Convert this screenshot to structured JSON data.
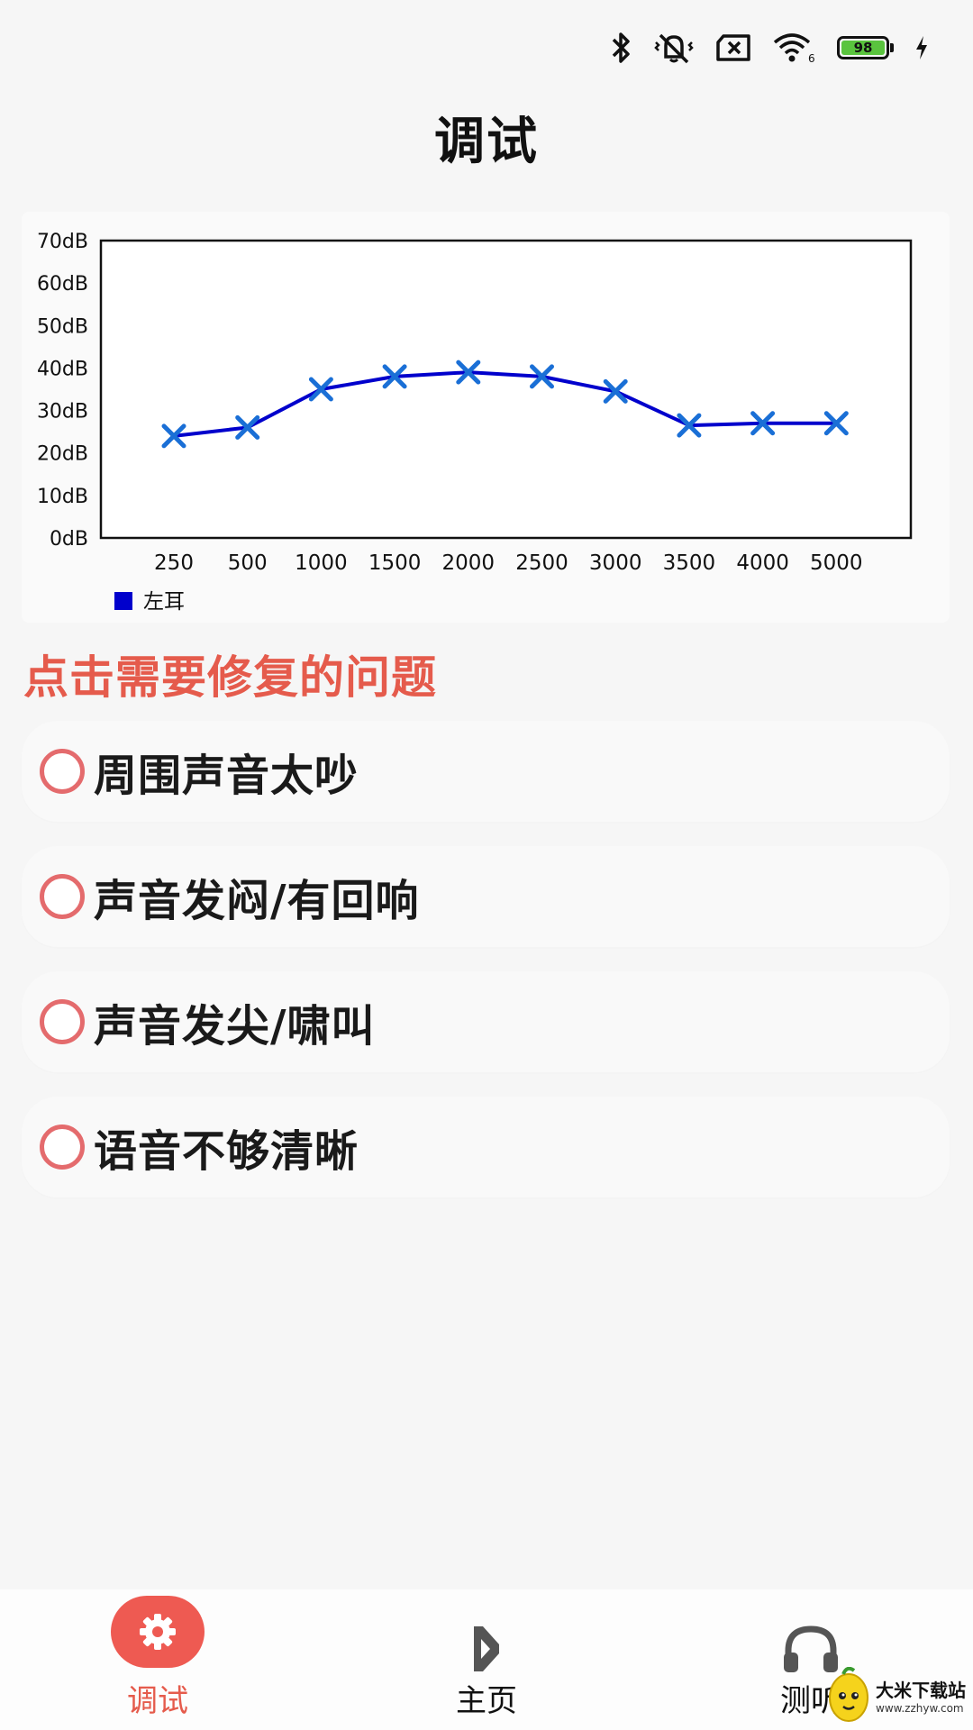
{
  "status_bar": {
    "battery_level": "98",
    "wifi_badge": "6",
    "icons": [
      "bluetooth-icon",
      "mute-vibrate-icon",
      "sim-off-icon",
      "wifi-icon",
      "battery-icon",
      "charging-icon"
    ]
  },
  "header": {
    "title": "调试"
  },
  "chart_data": {
    "type": "line",
    "categories": [
      "250",
      "500",
      "1000",
      "1500",
      "2000",
      "2500",
      "3000",
      "3500",
      "4000",
      "5000"
    ],
    "y_ticks": [
      "0dB",
      "10dB",
      "20dB",
      "30dB",
      "40dB",
      "50dB",
      "60dB",
      "70dB"
    ],
    "ylim": [
      0,
      70
    ],
    "series": [
      {
        "name": "左耳",
        "values": [
          24,
          26,
          35,
          38,
          39,
          38,
          34.5,
          26.5,
          27,
          27
        ],
        "color": "#0000cc",
        "marker_color": "#1a6fd6"
      }
    ],
    "legend_position": "bottom-left",
    "grid": false
  },
  "problems": {
    "heading": "点击需要修复的问题",
    "items": [
      {
        "label": "周围声音太吵"
      },
      {
        "label": "声音发闷/有回响"
      },
      {
        "label": "声音发尖/啸叫"
      },
      {
        "label": "语音不够清晰"
      }
    ]
  },
  "nav": {
    "items": [
      {
        "label": "调试",
        "icon": "gear-icon",
        "active": true
      },
      {
        "label": "主页",
        "icon": "home-icon",
        "active": false
      },
      {
        "label": "测听",
        "icon": "headphones-icon",
        "active": false
      }
    ]
  },
  "watermark": {
    "name": "大米下载站",
    "url": "www.zzhyw.com"
  },
  "colors": {
    "accent": "#e55b4c",
    "radio_ring": "#e46b6d",
    "nav_active_bg": "#ee5a52"
  }
}
